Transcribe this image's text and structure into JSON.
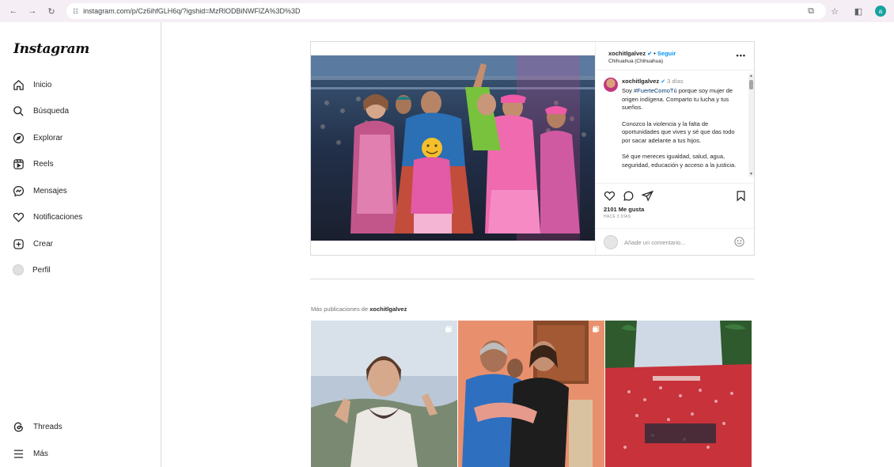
{
  "browser": {
    "url": "instagram.com/p/Cz6ihfGLH6q/?igshid=MzRlODBiNWFlZA%3D%3D",
    "profile_initial": "a"
  },
  "sidebar": {
    "logo": "Instagram",
    "items": [
      {
        "label": "Inicio",
        "icon": "home-icon"
      },
      {
        "label": "Búsqueda",
        "icon": "search-icon"
      },
      {
        "label": "Explorar",
        "icon": "compass-icon"
      },
      {
        "label": "Reels",
        "icon": "reels-icon"
      },
      {
        "label": "Mensajes",
        "icon": "messenger-icon"
      },
      {
        "label": "Notificaciones",
        "icon": "heart-icon"
      },
      {
        "label": "Crear",
        "icon": "plus-square-icon"
      },
      {
        "label": "Perfil",
        "icon": "avatar"
      }
    ],
    "bottom": [
      {
        "label": "Threads",
        "icon": "threads-icon"
      },
      {
        "label": "Más",
        "icon": "menu-icon"
      }
    ]
  },
  "post": {
    "username": "xochitlgalvez",
    "follow_label": "Seguir",
    "location": "Chihuahua (Chihuahua)",
    "caption": {
      "username": "xochitlgalvez",
      "time": "3 días",
      "para1_prefix": "Soy ",
      "hashtag": "#FuerteComoTú",
      "para1_suffix": " porque soy mujer de origen indígena. Comparto tu lucha y tus sueños.",
      "para2": "Conozco la violencia y la falta de oportunidades que vives y sé que das todo por sacar adelante a tus hijos.",
      "para3": "Sé que mereces igualdad, salud, agua, seguridad, educación y acceso a la justicia."
    },
    "likes": "2101 Me gusta",
    "date": "HACE 3 DÍAS",
    "comment_placeholder": "Añade un comentario..."
  },
  "more": {
    "prefix": "Más publicaciones de ",
    "username": "xochitlgalvez"
  },
  "colors": {
    "accent": "#0095f6",
    "border": "#dbdbdb",
    "pink": "#e0569c"
  }
}
